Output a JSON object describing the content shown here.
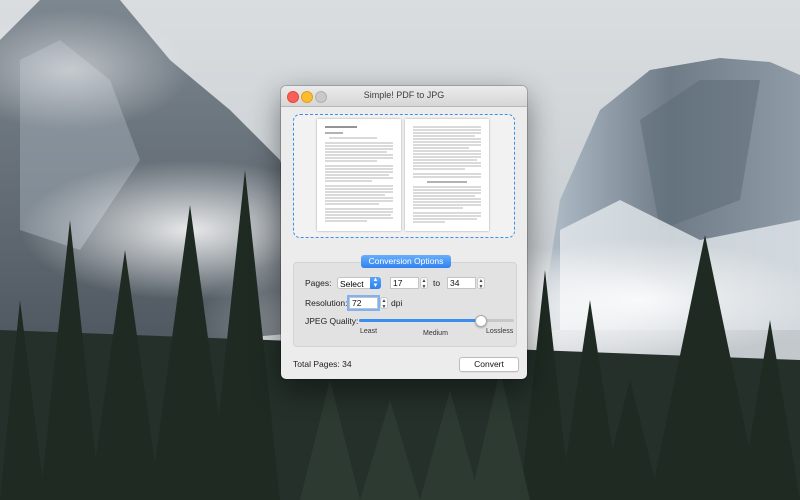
{
  "window": {
    "title": "Simple! PDF to JPG"
  },
  "options": {
    "section_label": "Conversion Options",
    "pages_label": "Pages:",
    "pages_mode": "Select",
    "page_from": "17",
    "to_label": "to",
    "page_to": "34",
    "resolution_label": "Resolution:",
    "resolution_value": "72",
    "dpi_label": "dpi",
    "quality_label": "JPEG Quality:",
    "quality_level": 0.78,
    "quality_ticks": [
      "Least",
      "Medium",
      "Lossless"
    ]
  },
  "footer": {
    "total_pages": "Total Pages: 34",
    "convert_label": "Convert"
  },
  "icons": {
    "select_arrow": "up-down-chevron-icon",
    "stepper": "stepper-icon"
  },
  "colors": {
    "accent": "#2f82f0",
    "drop_border": "#3d8fe6"
  }
}
